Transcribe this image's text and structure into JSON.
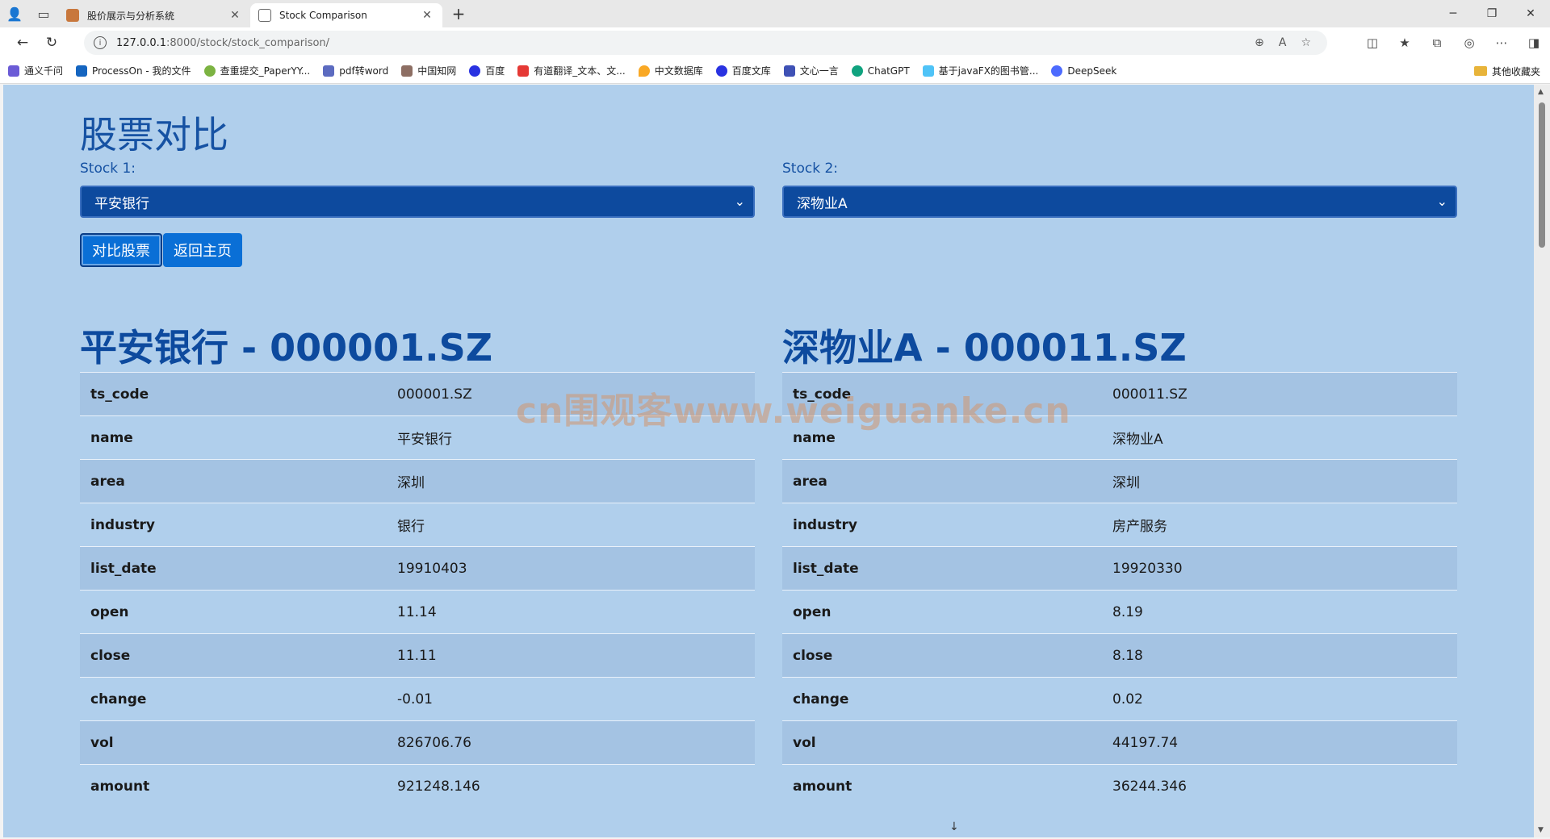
{
  "browser": {
    "tabs": [
      {
        "title": "股价展示与分析系统",
        "active": false
      },
      {
        "title": "Stock Comparison",
        "active": true
      }
    ],
    "url_host": "127.0.0.1",
    "url_rest": ":8000/stock/stock_comparison/",
    "bookmarks": [
      "通义千问",
      "ProcessOn - 我的文件",
      "查重提交_PaperYY...",
      "pdf转word",
      "中国知网",
      "百度",
      "有道翻译_文本、文...",
      "中文数据库",
      "百度文库",
      "文心一言",
      "ChatGPT",
      "基于javaFX的图书管...",
      "DeepSeek"
    ],
    "other_bookmarks": "其他收藏夹"
  },
  "page": {
    "title": "股票对比",
    "stock1_label": "Stock 1:",
    "stock2_label": "Stock 2:",
    "stock1_selected": "平安银行",
    "stock2_selected": "深物业A",
    "compare_button": "对比股票",
    "back_button": "返回主页",
    "watermark": "cn围观客www.weiguanke.cn"
  },
  "stocks": [
    {
      "heading": "平安银行 - 000001.SZ",
      "rows": [
        [
          "ts_code",
          "000001.SZ"
        ],
        [
          "name",
          "平安银行"
        ],
        [
          "area",
          "深圳"
        ],
        [
          "industry",
          "银行"
        ],
        [
          "list_date",
          "19910403"
        ],
        [
          "open",
          "11.14"
        ],
        [
          "close",
          "11.11"
        ],
        [
          "change",
          "-0.01"
        ],
        [
          "vol",
          "826706.76"
        ],
        [
          "amount",
          "921248.146"
        ]
      ]
    },
    {
      "heading": "深物业A - 000011.SZ",
      "rows": [
        [
          "ts_code",
          "000011.SZ"
        ],
        [
          "name",
          "深物业A"
        ],
        [
          "area",
          "深圳"
        ],
        [
          "industry",
          "房产服务"
        ],
        [
          "list_date",
          "19920330"
        ],
        [
          "open",
          "8.19"
        ],
        [
          "close",
          "8.18"
        ],
        [
          "change",
          "0.02"
        ],
        [
          "vol",
          "44197.74"
        ],
        [
          "amount",
          "36244.346"
        ]
      ]
    }
  ]
}
